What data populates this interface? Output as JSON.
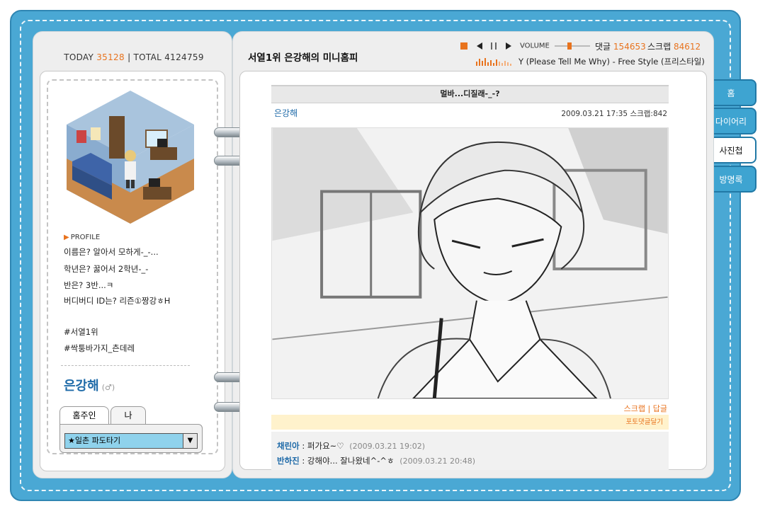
{
  "counter": {
    "today_label": "TODAY",
    "today": "35128",
    "sep": "|",
    "total_label": "TOTAL",
    "total": "4124759"
  },
  "profile": {
    "header": "PROFILE",
    "lines": [
      "이름은? 알아서 모하게-_-...",
      "학년은? 꿇어서 2학년-_-",
      "반은? 3반...ㅋ",
      "버디버디 ID는? 리즌①짱강ㅎH",
      "#서열1위",
      "#싹퉁바가지_츤데레"
    ],
    "name": "은강해",
    "gender": "(♂)"
  },
  "mini_tabs": {
    "owner": "홈주인",
    "me": "나"
  },
  "ilchon": {
    "selected": "★일촌 파도타기"
  },
  "header": {
    "site_title": "서열1위 은강해의 미니홈피",
    "volume_label": "VOLUME",
    "comments_label": "댓글",
    "comments": "154653",
    "scrap_label": "스크랩",
    "scrap": "84612",
    "song": "Y (Please Tell Me Why) - Free Style (프리스타일)"
  },
  "post": {
    "title": "멀바...디질래-_-?",
    "author": "은강해",
    "date": "2009.03.21 17:35",
    "scrap_count": "스크랩:842",
    "action_scrap": "스크랩",
    "action_sep": "|",
    "action_reply": "답글",
    "reply_bar": "포토댓글달기"
  },
  "comments_list": [
    {
      "who": "채린아",
      "text": ": 퍼가요~♡",
      "when": "(2009.03.21 19:02)"
    },
    {
      "who": "반하진",
      "text": ": 강해야... 잘나왔네^-^ㅎ",
      "when": "(2009.03.21 20:48)"
    }
  ],
  "nav": [
    "홈",
    "다이어리",
    "사진첩",
    "방명록"
  ],
  "nav_active": "사진첩",
  "colors": {
    "binder": "#4aa8d4",
    "accent": "#e8731e",
    "link": "#1e6aa8"
  }
}
